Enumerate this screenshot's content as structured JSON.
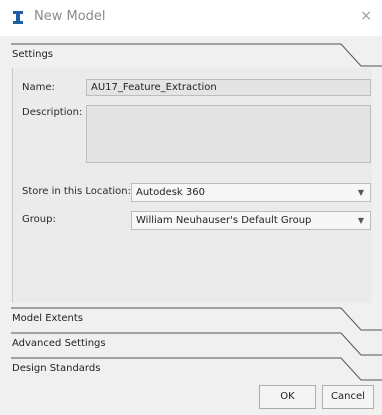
{
  "window": {
    "title": "New Model",
    "close_glyph": "×",
    "icon": "infraworks-app-icon"
  },
  "sections": {
    "settings": "Settings",
    "model_extents": "Model Extents",
    "advanced_settings": "Advanced Settings",
    "design_standards": "Design Standards"
  },
  "form": {
    "name_label": "Name:",
    "name_value": "AU17_Feature_Extraction",
    "description_label": "Description:",
    "description_value": "",
    "location_label": "Store in this Location:",
    "location_value": "Autodesk 360",
    "group_label": "Group:",
    "group_value": "William Neuhauser's Default Group"
  },
  "buttons": {
    "ok": "OK",
    "cancel": "Cancel"
  },
  "colors": {
    "accent": "#1f5fa8",
    "dialog_bg": "#f0f0f0",
    "field_bg": "#e4e4e4"
  }
}
